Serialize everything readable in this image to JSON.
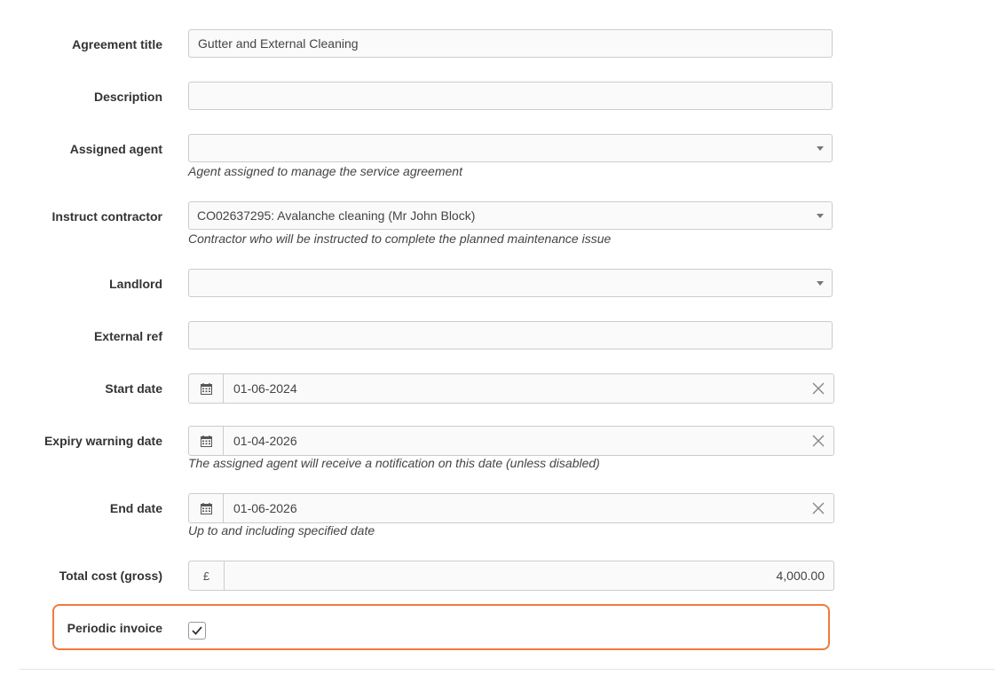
{
  "form": {
    "agreement_title": {
      "label": "Agreement title",
      "value": "Gutter and External Cleaning"
    },
    "description": {
      "label": "Description",
      "value": ""
    },
    "assigned_agent": {
      "label": "Assigned agent",
      "value": "",
      "help": "Agent assigned to manage the service agreement"
    },
    "instruct_contractor": {
      "label": "Instruct contractor",
      "value": "CO02637295: Avalanche cleaning (Mr John Block)",
      "help": "Contractor who will be instructed to complete the planned maintenance issue"
    },
    "landlord": {
      "label": "Landlord",
      "value": ""
    },
    "external_ref": {
      "label": "External ref",
      "value": ""
    },
    "start_date": {
      "label": "Start date",
      "value": "01-06-2024"
    },
    "expiry_warning_date": {
      "label": "Expiry warning date",
      "value": "01-04-2026",
      "help": "The assigned agent will receive a notification on this date (unless disabled)"
    },
    "end_date": {
      "label": "End date",
      "value": "01-06-2026",
      "help": "Up to and including specified date"
    },
    "total_cost": {
      "label": "Total cost (gross)",
      "currency": "£",
      "value": "4,000.00"
    },
    "periodic_invoice": {
      "label": "Periodic invoice",
      "checked": true
    }
  },
  "icons": {
    "calendar": "calendar-icon",
    "clear": "close-icon",
    "caret": "chevron-down-icon",
    "check": "checkmark-icon"
  },
  "colors": {
    "highlight": "#f07a3e",
    "border": "#cccccc",
    "field_bg": "#fafafa"
  }
}
